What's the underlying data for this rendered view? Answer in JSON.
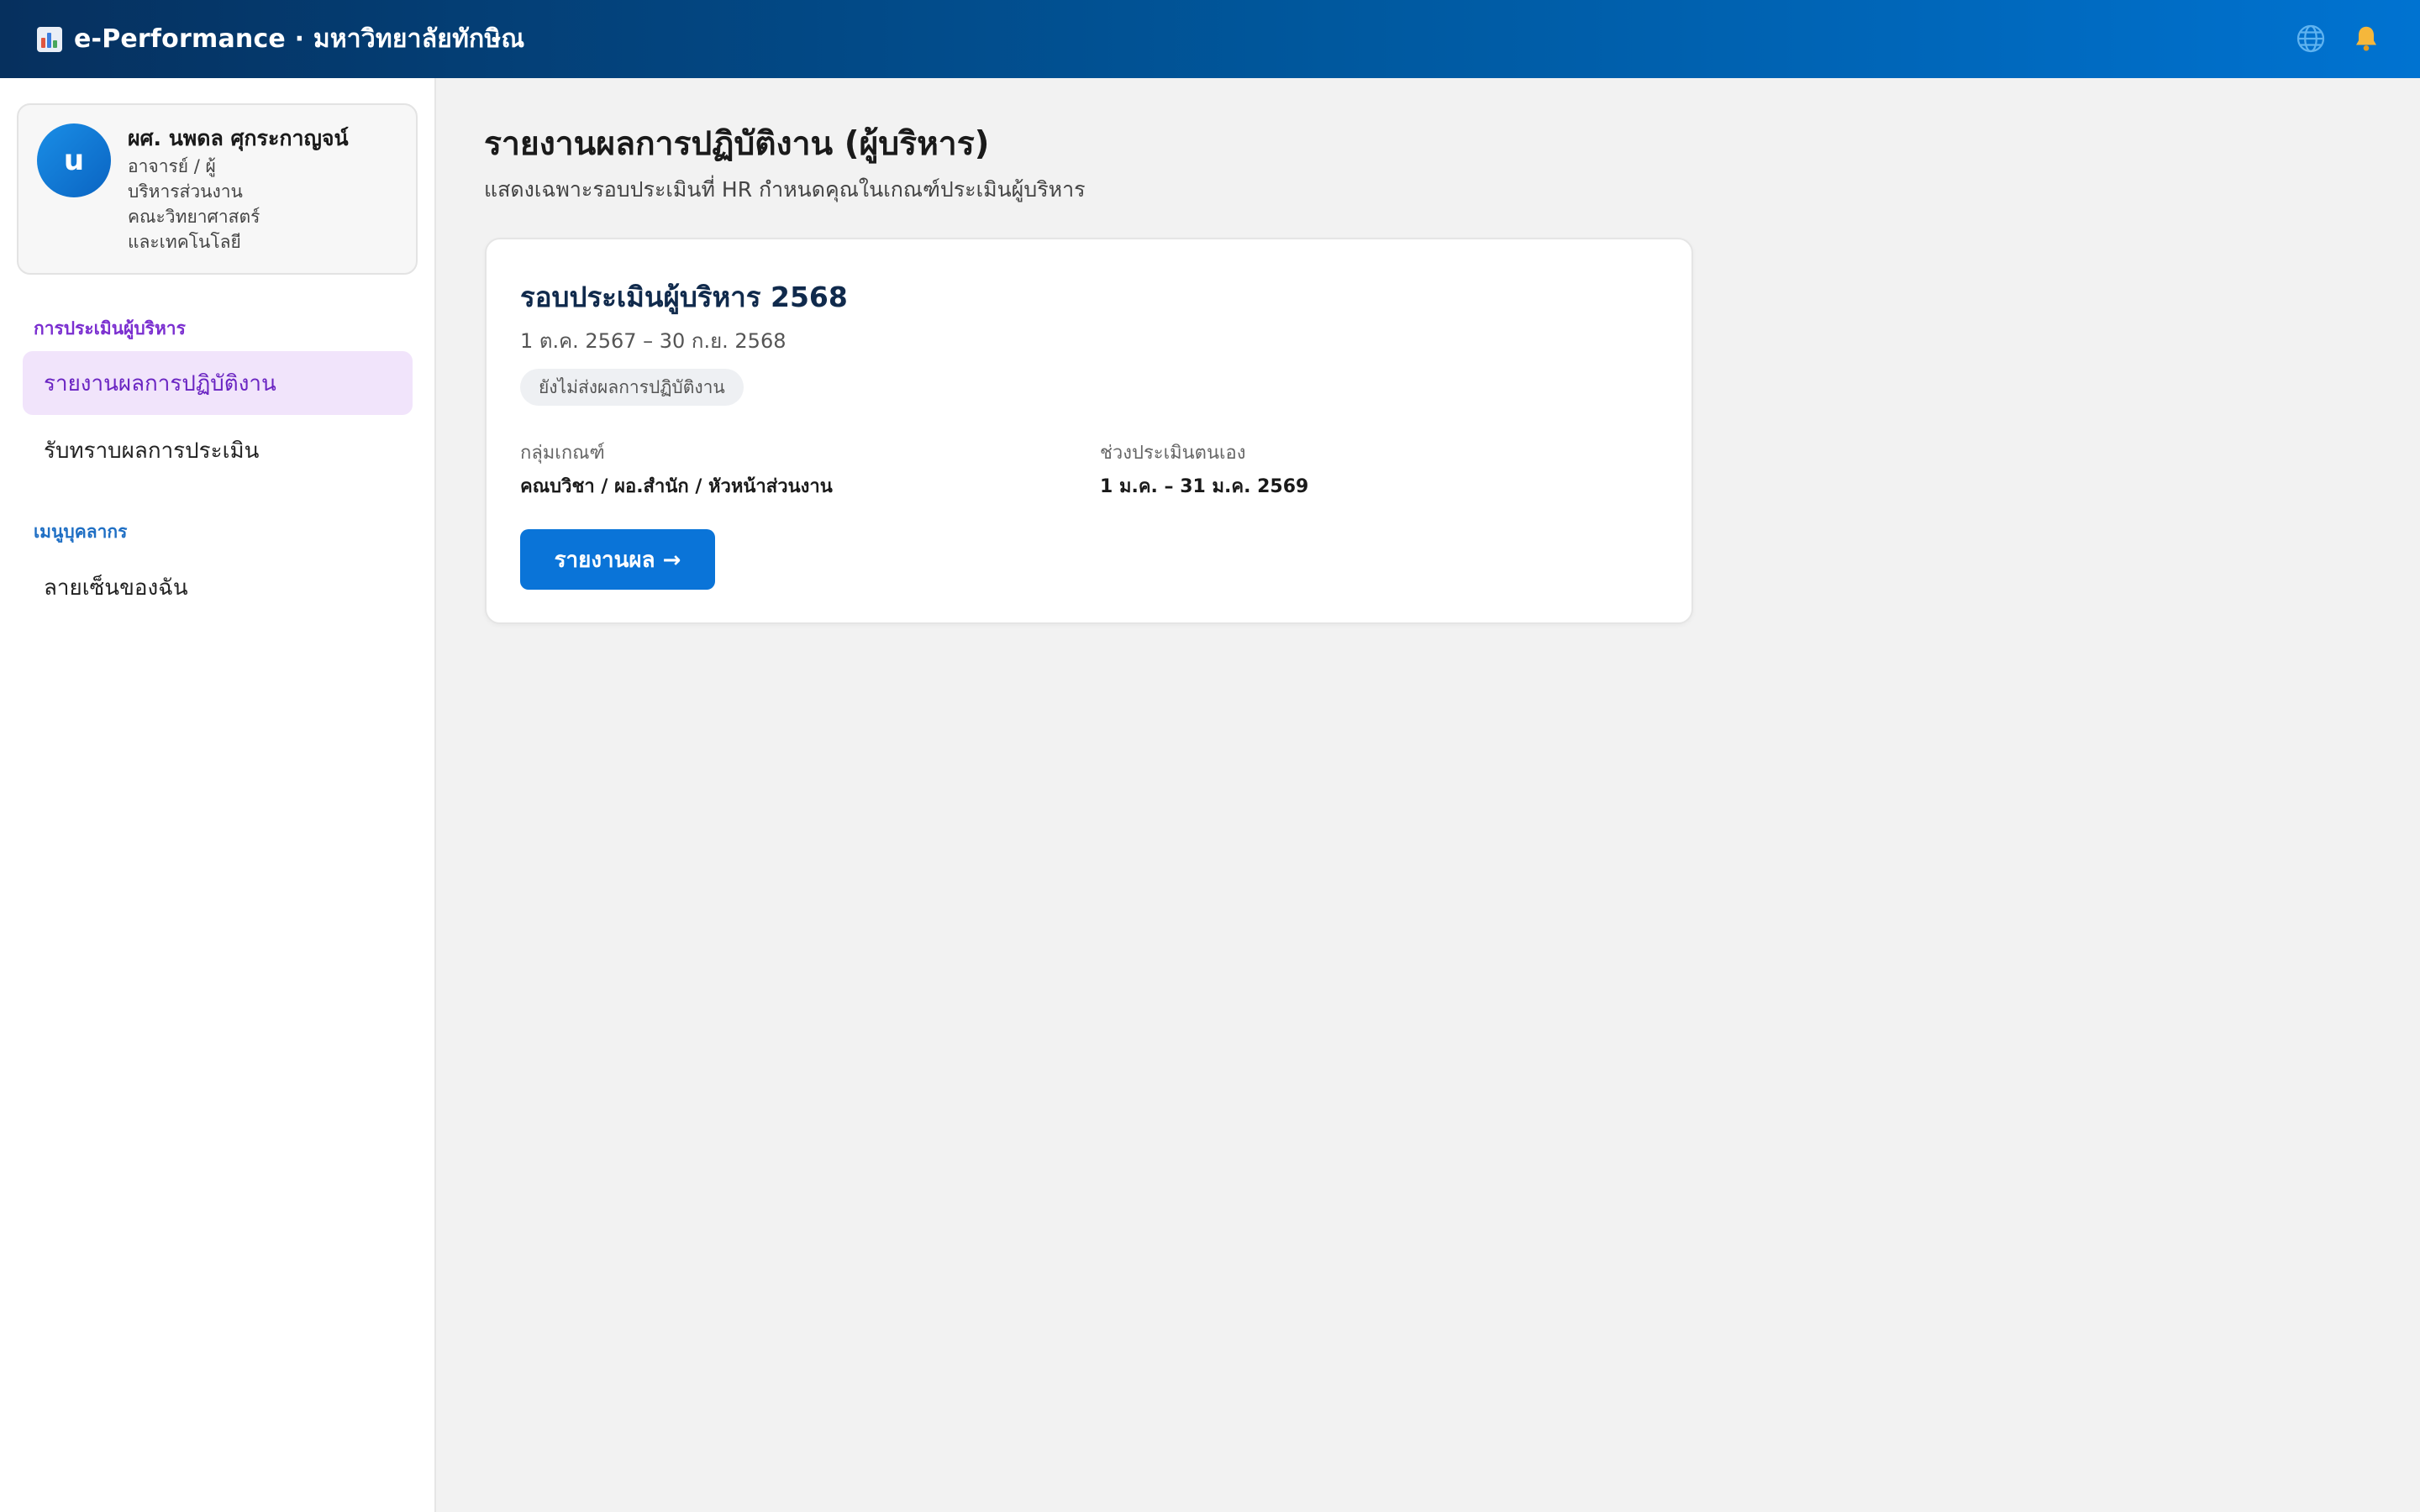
{
  "app": {
    "title": "e-Performance · มหาวิทยาลัยทักษิณ",
    "logo_icon": "bar-chart-icon",
    "language_icon": "globe-icon",
    "notification_icon": "bell-icon",
    "colors": {
      "header_start": "#06305e",
      "header_end": "#0073d1",
      "accent_blue": "#0a74d8",
      "accent_purple": "#7b2fd0",
      "active_nav_bg": "#f1e4fb"
    }
  },
  "profile": {
    "avatar_initial": "u",
    "name": "ผศ. นพดล ศุกระกาญจน์",
    "role_lines": [
      "อาจารย์ / ผู้",
      "บริหารส่วนงาน",
      "คณะวิทยาศาสตร์",
      "และเทคโนโลยี"
    ]
  },
  "sidebar": {
    "section_admin": "การประเมินผู้บริหาร",
    "admin_items": [
      {
        "label": "รายงานผลการปฏิบัติงาน",
        "active": true
      },
      {
        "label": "รับทราบผลการประเมิน",
        "active": false
      }
    ],
    "section_staff": "เมนูบุคลากร",
    "staff_items": [
      {
        "label": "ลายเซ็นของฉัน",
        "active": false
      }
    ]
  },
  "main": {
    "title": "รายงานผลการปฏิบัติงาน (ผู้บริหาร)",
    "subtitle": "แสดงเฉพาะรอบประเมินที่ HR กำหนดคุณในเกณฑ์ประเมินผู้บริหาร",
    "card": {
      "title": "รอบประเมินผู้บริหาร 2568",
      "dates": "1 ต.ค. 2567 – 30 ก.ย. 2568",
      "status": "ยังไม่ส่งผลการปฏิบัติงาน",
      "criteria_label": "กลุ่มเกณฑ์",
      "criteria_value": "คณบวิชา / ผอ.สำนัก / หัวหน้าส่วนงาน",
      "self_eval_label": "ช่วงประเมินตนเอง",
      "self_eval_value": "1 ม.ค. – 31 ม.ค. 2569",
      "action_label": "รายงานผล →"
    }
  }
}
